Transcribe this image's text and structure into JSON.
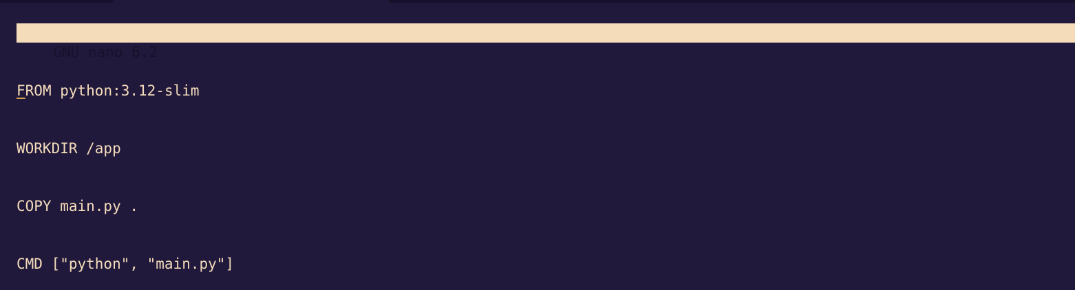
{
  "colors": {
    "background": "#21193b",
    "titlebar_background": "#f4dcbb",
    "titlebar_text": "#16112b",
    "editor_text": "#f4dcbb",
    "cursor": "#d8a24a"
  },
  "titlebar": {
    "text": "GNU nano 6.2"
  },
  "editor": {
    "cursor_char": "F",
    "line1_rest": "ROM python:3.12-slim",
    "lines": [
      "WORKDIR /app",
      "COPY main.py .",
      "CMD [\"python\", \"main.py\"]"
    ]
  }
}
